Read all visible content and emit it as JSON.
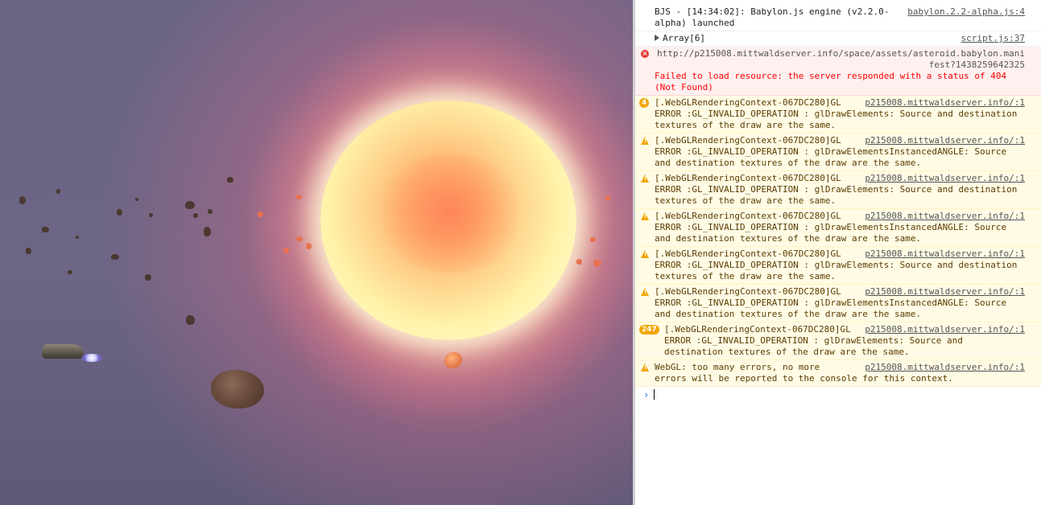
{
  "console": {
    "messages": [
      {
        "type": "log",
        "source": "babylon.2.2-alpha.js:4",
        "text": "BJS - [14:34:02]: Babylon.js engine (v2.2.0-alpha) launched"
      },
      {
        "type": "log-expand",
        "source": "script.js:37",
        "text": "Array[6]"
      },
      {
        "type": "error",
        "source": "",
        "url": "http://p215008.mittwaldserver.info/space/assets/asteroid.babylon.manifest?1438259642325",
        "text": "Failed to load resource: the server responded with a status of 404 (Not Found)"
      },
      {
        "type": "warn",
        "count": "4",
        "source": "p215008.mittwaldserver.info/:1",
        "text": "[.WebGLRenderingContext-067DC280]GL ERROR :GL_INVALID_OPERATION : glDrawElements: Source and destination textures of the draw are the same."
      },
      {
        "type": "warn",
        "count": "",
        "source": "p215008.mittwaldserver.info/:1",
        "text": "[.WebGLRenderingContext-067DC280]GL ERROR :GL_INVALID_OPERATION : glDrawElementsInstancedANGLE: Source and destination textures of the draw are the same."
      },
      {
        "type": "warn",
        "count": "",
        "source": "p215008.mittwaldserver.info/:1",
        "text": "[.WebGLRenderingContext-067DC280]GL ERROR :GL_INVALID_OPERATION : glDrawElements: Source and destination textures of the draw are the same."
      },
      {
        "type": "warn",
        "count": "",
        "source": "p215008.mittwaldserver.info/:1",
        "text": "[.WebGLRenderingContext-067DC280]GL ERROR :GL_INVALID_OPERATION : glDrawElementsInstancedANGLE: Source and destination textures of the draw are the same."
      },
      {
        "type": "warn",
        "count": "",
        "source": "p215008.mittwaldserver.info/:1",
        "text": "[.WebGLRenderingContext-067DC280]GL ERROR :GL_INVALID_OPERATION : glDrawElements: Source and destination textures of the draw are the same."
      },
      {
        "type": "warn",
        "count": "",
        "source": "p215008.mittwaldserver.info/:1",
        "text": "[.WebGLRenderingContext-067DC280]GL ERROR :GL_INVALID_OPERATION : glDrawElementsInstancedANGLE: Source and destination textures of the draw are the same."
      },
      {
        "type": "warn",
        "count": "247",
        "source": "p215008.mittwaldserver.info/:1",
        "text": "[.WebGLRenderingContext-067DC280]GL ERROR :GL_INVALID_OPERATION : glDrawElements: Source and destination textures of the draw are the same."
      },
      {
        "type": "warn",
        "count": "",
        "source": "p215008.mittwaldserver.info/:1",
        "text": "WebGL: too many errors, no more errors will be reported to the console for this context."
      }
    ],
    "prompt_symbol": "›"
  },
  "colors": {
    "warn": "#f2a600",
    "error": "#e53935",
    "link": "#545454"
  }
}
